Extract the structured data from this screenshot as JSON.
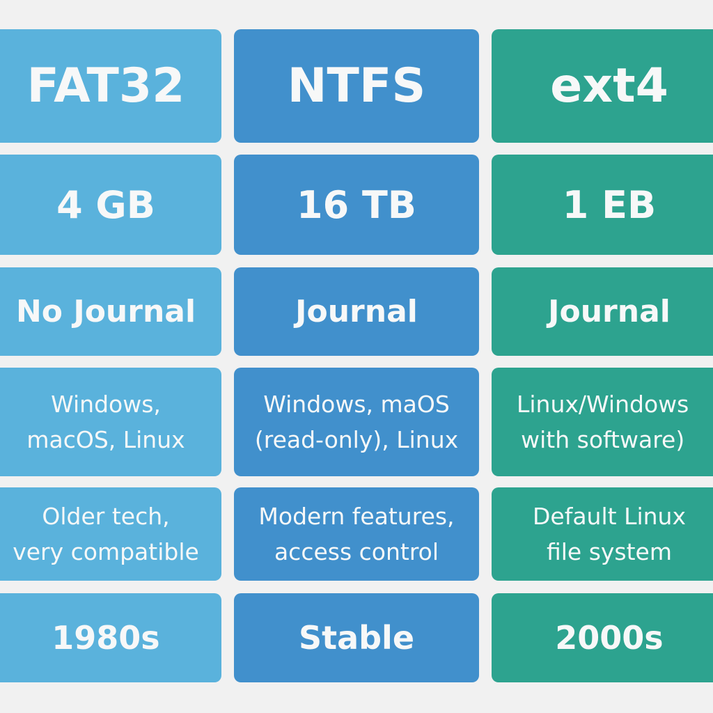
{
  "colors": {
    "fat32": "#5ab2dc",
    "ntfs": "#4190cc",
    "ext4": "#2da38f",
    "background": "#f1f1f1",
    "text": "#f7f8f8"
  },
  "columns": [
    {
      "cells": [
        "FAT32",
        "4 GB",
        "No Journal",
        "Windows,\nmacOS, Linux",
        "Older tech,\nvery compatible",
        "1980s"
      ]
    },
    {
      "cells": [
        "NTFS",
        "16 TB",
        "Journal",
        "Windows, maOS\n(read-only), Linux",
        "Modern features,\naccess control",
        "Stable"
      ]
    },
    {
      "cells": [
        "ext4",
        "1 EB",
        "Journal",
        "Linux/Windows\nwith software)",
        "Default Linux\nfile system",
        "2000s"
      ]
    }
  ]
}
